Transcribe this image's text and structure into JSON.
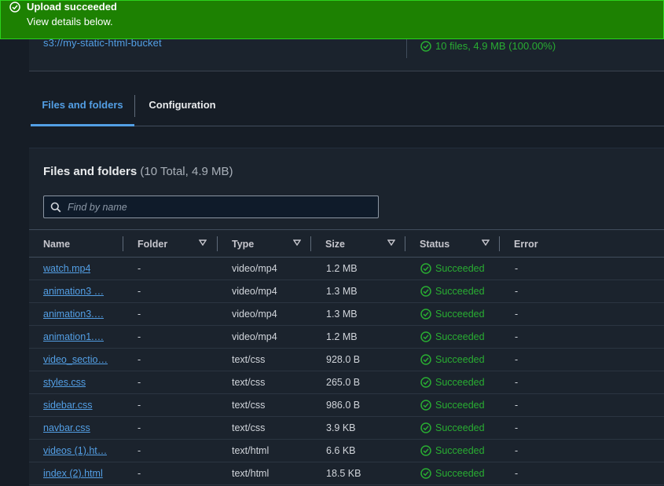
{
  "banner": {
    "title": "Upload succeeded",
    "subtitle": "View details below.",
    "icon": "check-circle-icon",
    "color": "#1d8102"
  },
  "summary": {
    "destination": "s3://my-static-html-bucket",
    "succeeded_stat": "10 files, 4.9 MB (100.00%)"
  },
  "tabs": [
    {
      "label": "Files and folders",
      "active": true
    },
    {
      "label": "Configuration",
      "active": false
    }
  ],
  "files_panel": {
    "title": "Files and folders",
    "count": "(10 Total, 4.9 MB)",
    "search_placeholder": "Find by name"
  },
  "table": {
    "columns": [
      "Name",
      "Folder",
      "Type",
      "Size",
      "Status",
      "Error"
    ],
    "rows": [
      {
        "name": "watch.mp4",
        "folder": "-",
        "type": "video/mp4",
        "size": "1.2 MB",
        "status": "Succeeded",
        "error": "-"
      },
      {
        "name": "animation3 …",
        "folder": "-",
        "type": "video/mp4",
        "size": "1.3 MB",
        "status": "Succeeded",
        "error": "-"
      },
      {
        "name": "animation3.…",
        "folder": "-",
        "type": "video/mp4",
        "size": "1.3 MB",
        "status": "Succeeded",
        "error": "-"
      },
      {
        "name": "animation1.…",
        "folder": "-",
        "type": "video/mp4",
        "size": "1.2 MB",
        "status": "Succeeded",
        "error": "-"
      },
      {
        "name": "video_sectio…",
        "folder": "-",
        "type": "text/css",
        "size": "928.0 B",
        "status": "Succeeded",
        "error": "-"
      },
      {
        "name": "styles.css",
        "folder": "-",
        "type": "text/css",
        "size": "265.0 B",
        "status": "Succeeded",
        "error": "-"
      },
      {
        "name": "sidebar.css",
        "folder": "-",
        "type": "text/css",
        "size": "986.0 B",
        "status": "Succeeded",
        "error": "-"
      },
      {
        "name": "navbar.css",
        "folder": "-",
        "type": "text/css",
        "size": "3.9 KB",
        "status": "Succeeded",
        "error": "-"
      },
      {
        "name": "videos (1).ht…",
        "folder": "-",
        "type": "text/html",
        "size": "6.6 KB",
        "status": "Succeeded",
        "error": "-"
      },
      {
        "name": "index (2).html",
        "folder": "-",
        "type": "text/html",
        "size": "18.5 KB",
        "status": "Succeeded",
        "error": "-"
      }
    ]
  },
  "colors": {
    "link": "#539fe5",
    "success": "#29ad32",
    "banner": "#1d8102"
  }
}
